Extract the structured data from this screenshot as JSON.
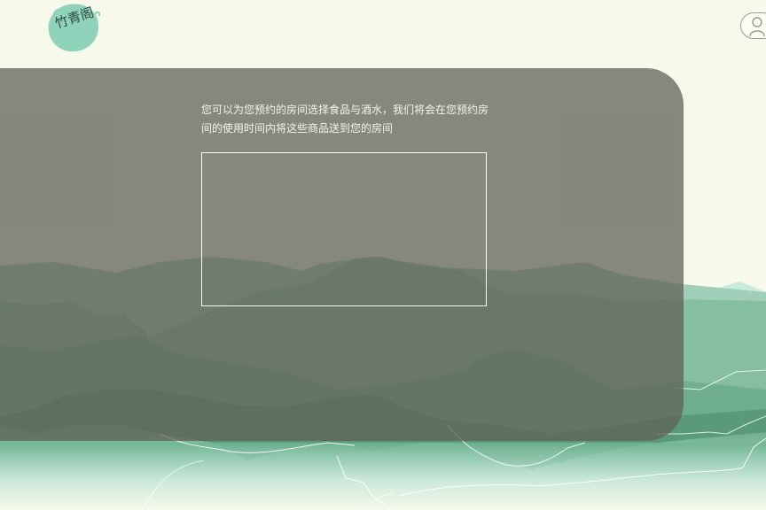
{
  "header": {
    "logo_text": "竹青阁",
    "logo_icon": "ink-bamboo-seal-logo",
    "user_icon": "user-profile-icon"
  },
  "main": {
    "intro_text": "您可以为您预约的房间选择食品与酒水，我们将会在您预约房间的使用时间内将这些商品送到您的房间"
  },
  "colors": {
    "page_background": "#f7f9ea",
    "panel_overlay": "#606058",
    "logo_mint": "#8fd3bb",
    "mountain_light": "#bfe5d3",
    "mountain_mid": "#8dcbb0",
    "mountain_dark": "#33563f"
  }
}
